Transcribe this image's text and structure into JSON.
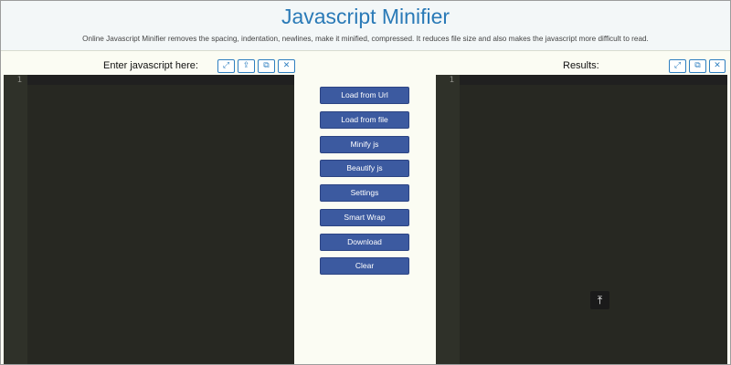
{
  "header": {
    "title": "Javascript Minifier",
    "subtitle": "Online Javascript Minifier removes the spacing, indentation, newlines, make it minified, compressed. It reduces file size and also makes the javascript more difficult to read."
  },
  "input_panel": {
    "label": "Enter javascript here:",
    "line_number": "1",
    "tools": [
      "fullscreen-icon",
      "upload-icon",
      "copy-icon",
      "close-icon"
    ]
  },
  "output_panel": {
    "label": "Results:",
    "line_number": "1",
    "tools": [
      "fullscreen-icon",
      "copy-icon",
      "close-icon"
    ]
  },
  "actions": {
    "load_url": "Load from Url",
    "load_file": "Load from file",
    "minify": "Minify js",
    "beautify": "Beautify js",
    "settings": "Settings",
    "smart_wrap": "Smart Wrap",
    "download": "Download",
    "clear": "Clear"
  },
  "icons": {
    "fullscreen": "⤢",
    "upload": "⇪",
    "copy": "⧉",
    "close": "✕",
    "scroll_top": "⤒"
  },
  "colors": {
    "title": "#2a7ab7",
    "editor_bg": "#272822",
    "gutter_bg": "#2f3129",
    "button_bg": "#3c5aa0",
    "tool_border": "#2f7fc0"
  }
}
